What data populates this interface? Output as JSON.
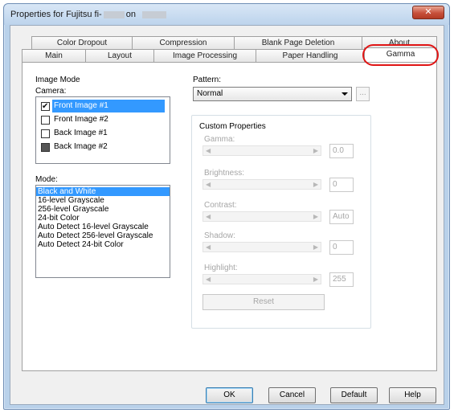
{
  "window": {
    "title_prefix": "Properties for Fujitsu fi-",
    "title_mid": "on",
    "close_label": "✕"
  },
  "tabs": {
    "back_row": [
      "Color Dropout",
      "Compression",
      "Blank Page Deletion",
      "About"
    ],
    "front_row": [
      "Main",
      "Layout",
      "Image Processing",
      "Paper Handling",
      "Gamma"
    ],
    "active": "Gamma"
  },
  "image_mode": {
    "heading": "Image Mode",
    "camera_label": "Camera:",
    "camera_items": [
      {
        "label": "Front Image #1",
        "state": "checked",
        "selected": true
      },
      {
        "label": "Front Image #2",
        "state": "unchecked",
        "selected": false
      },
      {
        "label": "Back Image #1",
        "state": "unchecked",
        "selected": false
      },
      {
        "label": "Back Image #2",
        "state": "indeterminate",
        "selected": false
      }
    ],
    "mode_label": "Mode:",
    "mode_items": [
      "Black and White",
      "16-level Grayscale",
      "256-level Grayscale",
      "24-bit Color",
      "Auto Detect 16-level Grayscale",
      "Auto Detect 256-level Grayscale",
      "Auto Detect 24-bit Color"
    ],
    "mode_selected": "Black and White"
  },
  "pattern": {
    "label": "Pattern:",
    "value": "Normal",
    "ellipsis_label": "..."
  },
  "custom": {
    "heading": "Custom Properties",
    "gamma": {
      "label": "Gamma:",
      "value": "0.0"
    },
    "brightness": {
      "label": "Brightness:",
      "value": "0"
    },
    "contrast": {
      "label": "Contrast:",
      "value": "Auto"
    },
    "shadow": {
      "label": "Shadow:",
      "value": "0"
    },
    "highlight": {
      "label": "Highlight:",
      "value": "255"
    },
    "reset_label": "Reset"
  },
  "buttons": {
    "ok": "OK",
    "cancel": "Cancel",
    "default": "Default",
    "help": "Help"
  },
  "colors": {
    "selection": "#3399ff",
    "highlight_circle": "#e01515",
    "close_button": "#c7503b"
  }
}
